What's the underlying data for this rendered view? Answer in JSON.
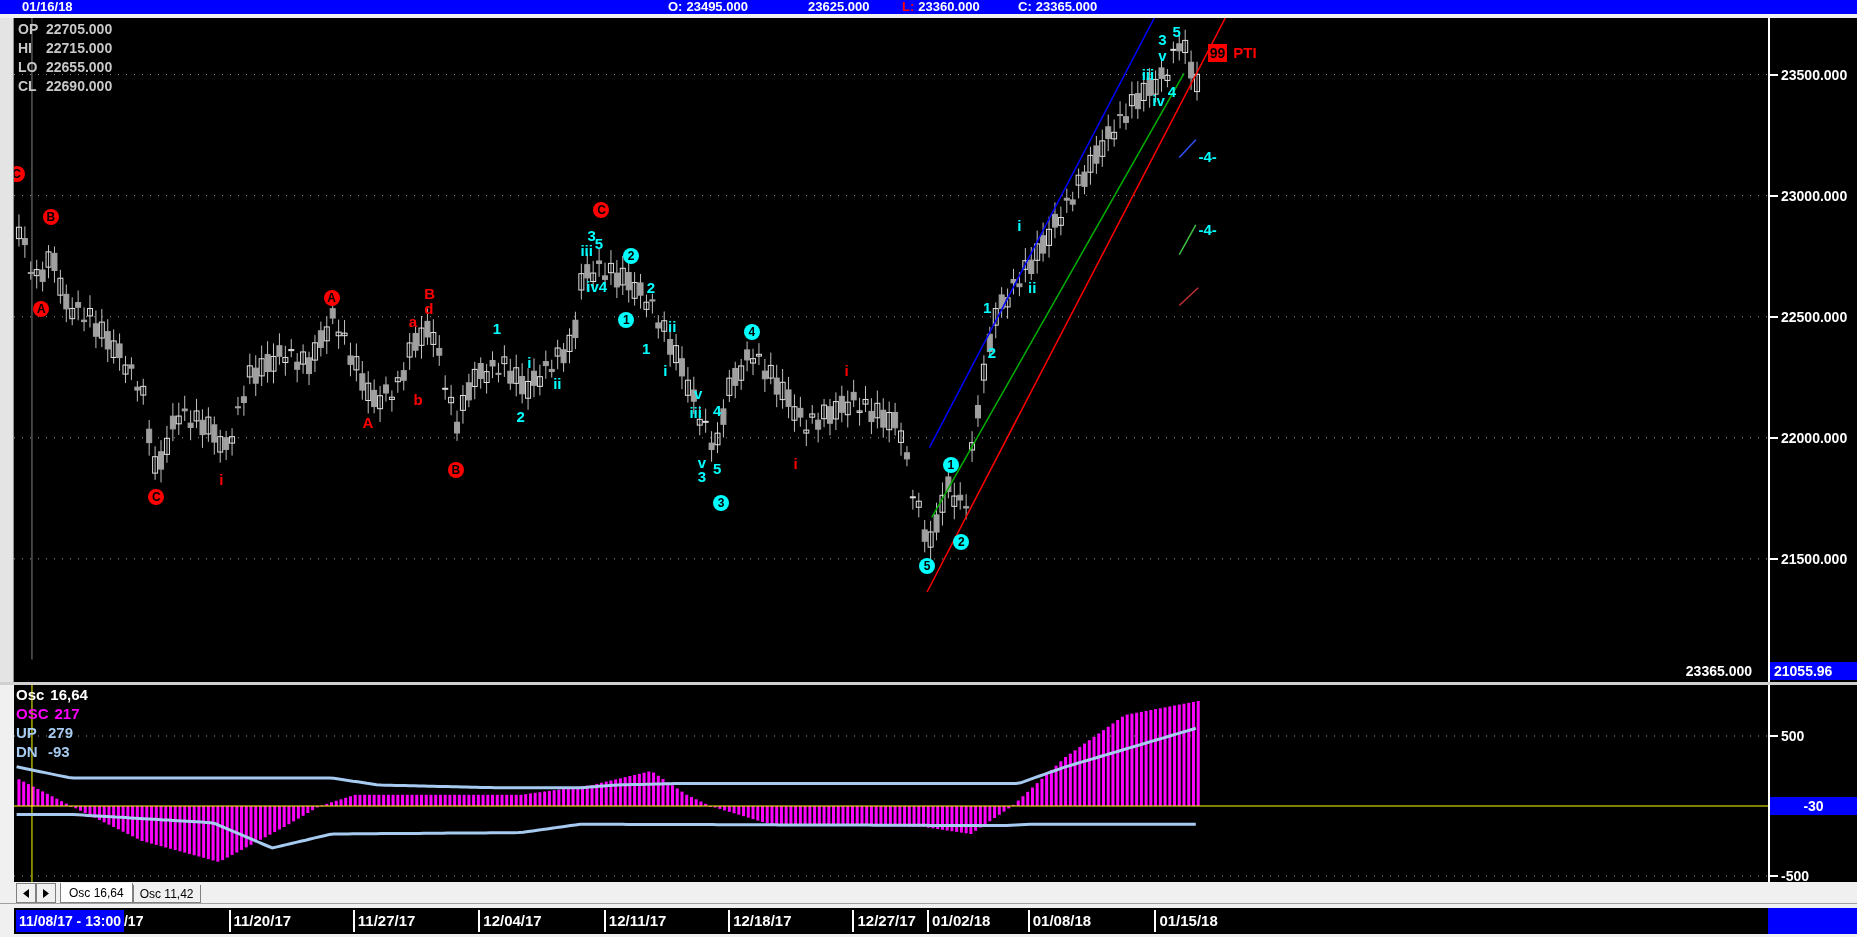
{
  "top_bar": {
    "date": "01/16/18",
    "quotes": [
      {
        "label": "O:",
        "value": "23495.000",
        "color": "#ffffff"
      },
      {
        "value": "23625.000"
      },
      {
        "label": "L:",
        "value": "23360.000",
        "color": "#ff0000"
      },
      {
        "label": "C:",
        "value": "23365.000",
        "color": "#ffffff"
      }
    ]
  },
  "price_panel": {
    "legend": [
      {
        "label": "OP",
        "value": "22705.000"
      },
      {
        "label": "HI",
        "value": "22715.000"
      },
      {
        "label": "LO",
        "value": "22655.000"
      },
      {
        "label": "CL",
        "value": "22690.000"
      }
    ],
    "wave_labels": [
      {
        "text": "C",
        "color": "#ff0000",
        "circled": true
      },
      {
        "text": "B",
        "color": "#ff0000",
        "circled": true
      },
      {
        "text": "A",
        "color": "#ff0000",
        "circled": true
      },
      {
        "text": "C",
        "color": "#ff0000",
        "circled": true
      },
      {
        "text": "i",
        "color": "#ff0000",
        "circled": false
      },
      {
        "text": "A",
        "color": "#ff0000",
        "circled": true
      },
      {
        "text": "A",
        "color": "#ff0000",
        "circled": false
      },
      {
        "text": "B",
        "color": "#ff0000",
        "circled": false
      },
      {
        "text": "d",
        "color": "#ff0000",
        "circled": false
      },
      {
        "text": "a",
        "color": "#ff0000",
        "circled": false
      },
      {
        "text": "b",
        "color": "#ff0000",
        "circled": false
      },
      {
        "text": "B",
        "color": "#ff0000",
        "circled": true
      },
      {
        "text": "1",
        "color": "#00ffff",
        "circled": false
      },
      {
        "text": "i",
        "color": "#00ffff",
        "circled": false
      },
      {
        "text": "2",
        "color": "#00ffff",
        "circled": false
      },
      {
        "text": "ii",
        "color": "#00ffff",
        "circled": false
      },
      {
        "text": "C",
        "color": "#ff0000",
        "circled": true
      },
      {
        "text": "3",
        "color": "#00ffff",
        "circled": false
      },
      {
        "text": "5",
        "color": "#00ffff",
        "circled": false
      },
      {
        "text": "iii",
        "color": "#00ffff",
        "circled": false
      },
      {
        "text": "iv4",
        "color": "#00ffff",
        "circled": false
      },
      {
        "text": "2",
        "color": "#00ffff",
        "circled": true
      },
      {
        "text": "2",
        "color": "#00ffff",
        "circled": false
      },
      {
        "text": "1",
        "color": "#00ffff",
        "circled": true
      },
      {
        "text": "1",
        "color": "#00ffff",
        "circled": false
      },
      {
        "text": "ii",
        "color": "#00ffff",
        "circled": false
      },
      {
        "text": "i",
        "color": "#00ffff",
        "circled": false
      },
      {
        "text": "v",
        "color": "#00ffff",
        "circled": false
      },
      {
        "text": "iii",
        "color": "#00ffff",
        "circled": false
      },
      {
        "text": "4",
        "color": "#00ffff",
        "circled": false
      },
      {
        "text": "4",
        "color": "#00ffff",
        "circled": true
      },
      {
        "text": "v",
        "color": "#00ffff",
        "circled": false
      },
      {
        "text": "3",
        "color": "#00ffff",
        "circled": false
      },
      {
        "text": "5",
        "color": "#00ffff",
        "circled": false
      },
      {
        "text": "3",
        "color": "#00ffff",
        "circled": true
      },
      {
        "text": "i",
        "color": "#ff0000",
        "circled": false
      },
      {
        "text": "i",
        "color": "#ff0000",
        "circled": false
      },
      {
        "text": "5",
        "color": "#00ffff",
        "circled": true
      },
      {
        "text": "1",
        "color": "#00ffff",
        "circled": true
      },
      {
        "text": "2",
        "color": "#00ffff",
        "circled": true
      },
      {
        "text": "1",
        "color": "#00ffff",
        "circled": false
      },
      {
        "text": "2",
        "color": "#00ffff",
        "circled": false
      },
      {
        "text": "i",
        "color": "#00ffff",
        "circled": false
      },
      {
        "text": "ii",
        "color": "#00ffff",
        "circled": false
      },
      {
        "text": "5",
        "color": "#00ffff",
        "circled": false
      },
      {
        "text": "3",
        "color": "#00ffff",
        "circled": false
      },
      {
        "text": "v",
        "color": "#00ffff",
        "circled": false
      },
      {
        "text": "iii",
        "color": "#00ffff",
        "circled": false
      },
      {
        "text": "4",
        "color": "#00ffff",
        "circled": false
      },
      {
        "text": "iv",
        "color": "#00ffff",
        "circled": false
      },
      {
        "text": "-4-",
        "color": "#00ffff",
        "circled": false
      },
      {
        "text": "-4-",
        "color": "#00ffff",
        "circled": false
      }
    ],
    "target": {
      "badge": "99",
      "label": "PTI"
    },
    "last_price": "23365.000",
    "axis": {
      "ticks": [
        "23500.000",
        "23000.000",
        "22500.000",
        "22000.000",
        "21500.000"
      ],
      "marker": "21055.96"
    }
  },
  "oscillator": {
    "legend": [
      {
        "label": "Osc",
        "value": "16,64",
        "color": "#ffffff"
      },
      {
        "label": "OSC",
        "value": "217",
        "color": "#ff00ff"
      },
      {
        "label": "UP",
        "value": "279",
        "color": "#a6caf0"
      },
      {
        "label": "DN",
        "value": "-93",
        "color": "#a6caf0"
      }
    ],
    "axis": {
      "ticks": [
        "500",
        "-500"
      ],
      "marker": "-30"
    },
    "tabs": [
      {
        "label": "Osc 16,64",
        "selected": true
      },
      {
        "label": "Osc 11,42",
        "selected": false
      }
    ]
  },
  "date_axis": {
    "cursor": "11/08/17 - 13:00",
    "labels": [
      "/17",
      "11/20/17",
      "11/27/17",
      "12/04/17",
      "12/11/17",
      "12/18/17",
      "12/27/17",
      "01/02/18",
      "01/08/18",
      "01/15/18"
    ]
  }
}
